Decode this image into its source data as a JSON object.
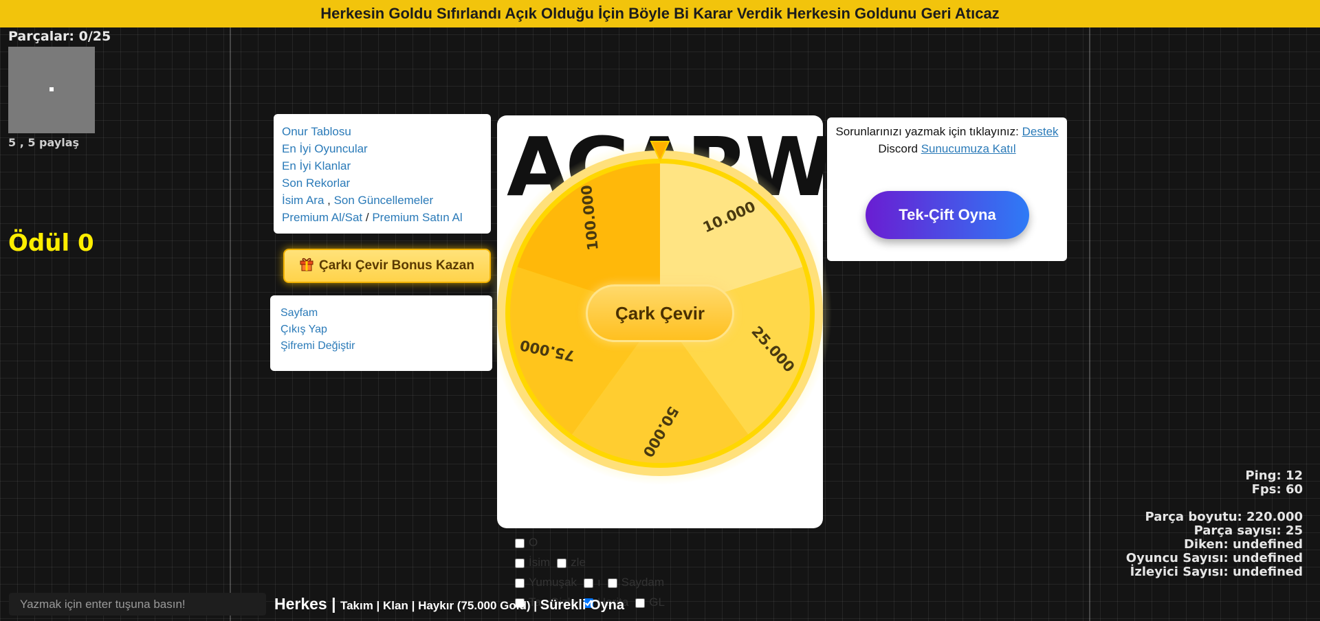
{
  "banner": "Herkesin Goldu Sıfırlandı Açık Olduğu İçin Böyle Bi Karar Verdik Herkesin Goldunu Geri Atıcaz",
  "hud": {
    "parts": "Parçalar: 0/25",
    "coords": "5 , 5 paylaş",
    "reward": "Ödül 0"
  },
  "menu": {
    "leaderboard": "Onur Tablosu",
    "top_players": "En İyi Oyuncular",
    "top_clans": "En İyi Klanlar",
    "last_records": "Son Rekorlar",
    "name_search": "İsim Ara",
    "sep_comma": " , ",
    "last_updates": "Son Güncellemeler",
    "premium_buysell": "Premium Al/Sat",
    "sep_slash": " / ",
    "premium_buy": "Premium Satın Al"
  },
  "bonus_button": "Çarkı Çevir Bonus Kazan",
  "account": {
    "my_page": "Sayfam",
    "logout": "Çıkış Yap",
    "change_password": "Şifremi Değiştir"
  },
  "logo": "AGARWS",
  "wheel": {
    "segments": [
      "10.000",
      "25.000",
      "50.000",
      "75.000",
      "100.000"
    ],
    "colors": [
      "#ffe483",
      "#ffd84a",
      "#ffcd30",
      "#ffc51c",
      "#ffb80a"
    ],
    "rim": "#ffd700",
    "spin_button": "Çark Çevir"
  },
  "options": {
    "row1": [
      {
        "label": "O",
        "checked": false
      }
    ],
    "row2": [
      {
        "label": "İsim",
        "checked": false
      },
      {
        "label": "zle",
        "checked": false
      }
    ],
    "row3": [
      {
        "label": "Yumuşak",
        "checked": false
      },
      {
        "label": "ı",
        "checked": false
      },
      {
        "label": "Saydam",
        "checked": false
      }
    ],
    "row4": [
      {
        "label": "Taç Gizle",
        "checked": false
      },
      {
        "label": "Harita",
        "checked": true
      },
      {
        "label": "GL",
        "checked": false
      }
    ]
  },
  "support": {
    "text": "Sorunlarınızı yazmak için tıklayınız:",
    "link": "Destek",
    "discord_text": "Discord",
    "discord_link": "Sunucumuza Katıl",
    "play_button": "Tek-Çift Oyna"
  },
  "stats": {
    "ping": "Ping: 12",
    "fps": "Fps: 60",
    "part_size": "Parça boyutu: 220.000",
    "part_count": "Parça sayısı: 25",
    "spike": "Diken: undefined",
    "player_count": "Oyuncu Sayısı: undefined",
    "viewer_count": "İzleyici Sayısı: undefined"
  },
  "chat": {
    "placeholder": "Yazmak için enter tuşuna basın!"
  },
  "modes": {
    "all": "Herkes",
    "sep": " | ",
    "team": "Takım",
    "clan": "Klan",
    "shout": "Haykır (75.000 Gold)",
    "continuous": "Sürekli Oyna"
  }
}
